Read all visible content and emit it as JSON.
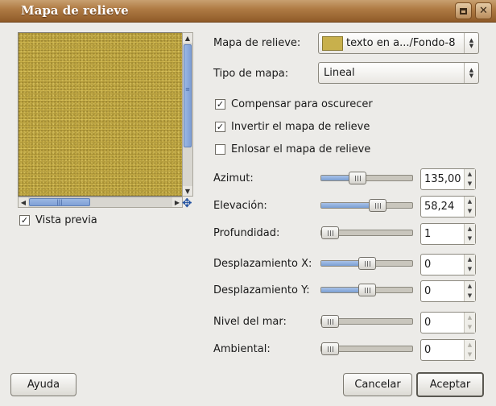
{
  "window": {
    "title": "Mapa de relieve"
  },
  "preview": {
    "checkbox_label": "Vista previa",
    "checked": true
  },
  "bumpmap": {
    "label": "Mapa de relieve:",
    "value": "texto en a.../Fondo-8",
    "swatch_color": "#c8b04c"
  },
  "map_type": {
    "label": "Tipo de mapa:",
    "value": "Lineal"
  },
  "options": [
    {
      "label": "Compensar para oscurecer",
      "checked": true
    },
    {
      "label": "Invertir el mapa de relieve",
      "checked": true
    },
    {
      "label": "Enlosar el mapa de relieve",
      "checked": false
    }
  ],
  "params": [
    {
      "label": "Azimut:",
      "value": "135,00",
      "level": 0.375
    },
    {
      "label": "Elevación:",
      "value": "58,24",
      "level": 0.647
    },
    {
      "label": "Profundidad:",
      "value": "1",
      "level": 0.0
    },
    {
      "label": "Desplazamiento X:",
      "value": "0",
      "level": 0.5
    },
    {
      "label": "Desplazamiento Y:",
      "value": "0",
      "level": 0.5
    },
    {
      "label": "Nivel del mar:",
      "value": "0",
      "level": 0.0
    },
    {
      "label": "Ambiental:",
      "value": "0",
      "level": 0.0
    }
  ],
  "buttons": {
    "help": "Ayuda",
    "cancel": "Cancelar",
    "ok": "Aceptar"
  },
  "colors": {
    "titlebar": "#b07c45",
    "slider_fill": "#7b9fd3",
    "texture": "#c8af48"
  }
}
